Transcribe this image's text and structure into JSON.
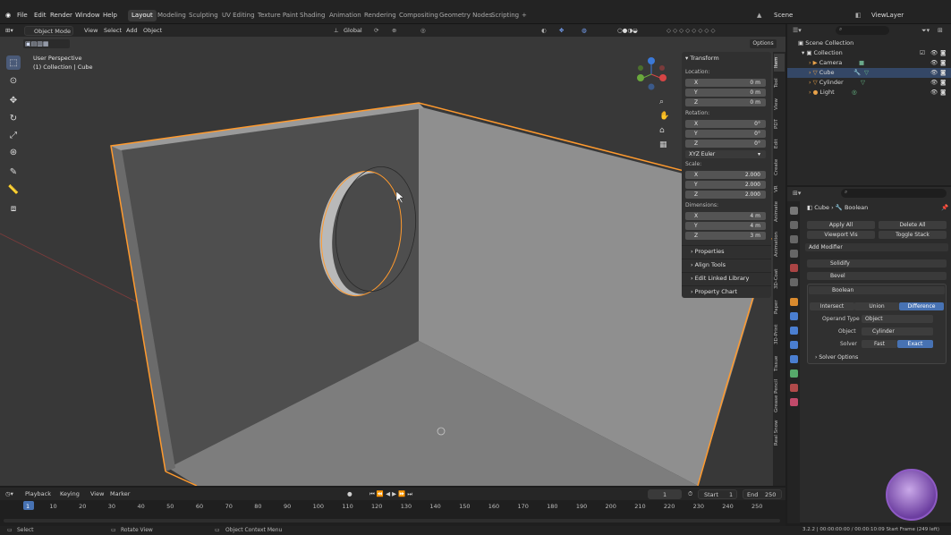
{
  "topmenu": {
    "items": [
      "File",
      "Edit",
      "Render",
      "Window",
      "Help"
    ]
  },
  "workspaces": {
    "tabs": [
      "Layout",
      "Modeling",
      "Sculpting",
      "UV Editing",
      "Texture Paint",
      "Shading",
      "Animation",
      "Rendering",
      "Compositing",
      "Geometry Nodes",
      "Scripting"
    ],
    "add": "+"
  },
  "scene": {
    "label": "Scene",
    "viewlayer": "ViewLayer"
  },
  "viewport_header": {
    "mode": "Object Mode",
    "menus": [
      "View",
      "Select",
      "Add",
      "Object"
    ],
    "orientation": "Global",
    "options": "Options"
  },
  "overlay_text": {
    "perspective": "User Perspective",
    "collection": "(1) Collection | Cube"
  },
  "npanel": {
    "transform": "Transform",
    "location_label": "Location:",
    "location": [
      {
        "ax": "X",
        "val": "0 m"
      },
      {
        "ax": "Y",
        "val": "0 m"
      },
      {
        "ax": "Z",
        "val": "0 m"
      }
    ],
    "rotation_label": "Rotation:",
    "rotation": [
      {
        "ax": "X",
        "val": "0°"
      },
      {
        "ax": "Y",
        "val": "0°"
      },
      {
        "ax": "Z",
        "val": "0°"
      }
    ],
    "rotation_mode": "XYZ Euler",
    "scale_label": "Scale:",
    "scale": [
      {
        "ax": "X",
        "val": "2.000"
      },
      {
        "ax": "Y",
        "val": "2.000"
      },
      {
        "ax": "Z",
        "val": "2.000"
      }
    ],
    "dimensions_label": "Dimensions:",
    "dimensions": [
      {
        "ax": "X",
        "val": "4 m"
      },
      {
        "ax": "Y",
        "val": "4 m"
      },
      {
        "ax": "Z",
        "val": "3 m"
      }
    ],
    "sections": [
      "Properties",
      "Align Tools",
      "Edit Linked Library",
      "Property Chart"
    ]
  },
  "vtabs": [
    "Item",
    "Tool",
    "View",
    "PDT",
    "Edit",
    "Create",
    "VR",
    "Animate",
    "Animation",
    "3D-Coat",
    "Paper",
    "3D-Print",
    "Tissue",
    "Grease Pencil",
    "Real Snow"
  ],
  "outliner": {
    "root": "Scene Collection",
    "collection": "Collection",
    "items": [
      "Camera",
      "Cube",
      "Cylinder",
      "Light"
    ],
    "selected": "Cube"
  },
  "properties": {
    "breadcrumb_obj": "Cube",
    "breadcrumb_mod": "Boolean",
    "apply_all": "Apply All",
    "delete_all": "Delete All",
    "viewport_vis": "Viewport Vis",
    "toggle_stack": "Toggle Stack",
    "add_modifier": "Add Modifier",
    "modifiers": [
      "Solidify",
      "Bevel",
      "Boolean"
    ],
    "ops": [
      "Intersect",
      "Union",
      "Difference"
    ],
    "operand_label": "Operand Type",
    "operand_value": "Object",
    "object_label": "Object",
    "object_value": "Cylinder",
    "solver_label": "Solver",
    "solver_fast": "Fast",
    "solver_exact": "Exact",
    "solver_options": "Solver Options"
  },
  "timeline": {
    "menus": [
      "Playback",
      "Keying",
      "View",
      "Marker"
    ],
    "current": "1",
    "start_label": "Start",
    "start": "1",
    "end_label": "End",
    "end": "250",
    "ticks": [
      "1",
      "10",
      "20",
      "30",
      "40",
      "50",
      "60",
      "70",
      "80",
      "90",
      "100",
      "110",
      "120",
      "130",
      "140",
      "150",
      "160",
      "170",
      "180",
      "190",
      "200",
      "210",
      "220",
      "230",
      "240",
      "250"
    ]
  },
  "status": {
    "select": "Select",
    "rotate": "Rotate View",
    "context": "Object Context Menu",
    "info": "3.2.2 | 00:00:00:00 / 00:00:10:09 Start Frame (249 left)"
  },
  "colors": {
    "accent": "#4772b3",
    "selection": "#ff9a2e",
    "bg": "#383838"
  }
}
